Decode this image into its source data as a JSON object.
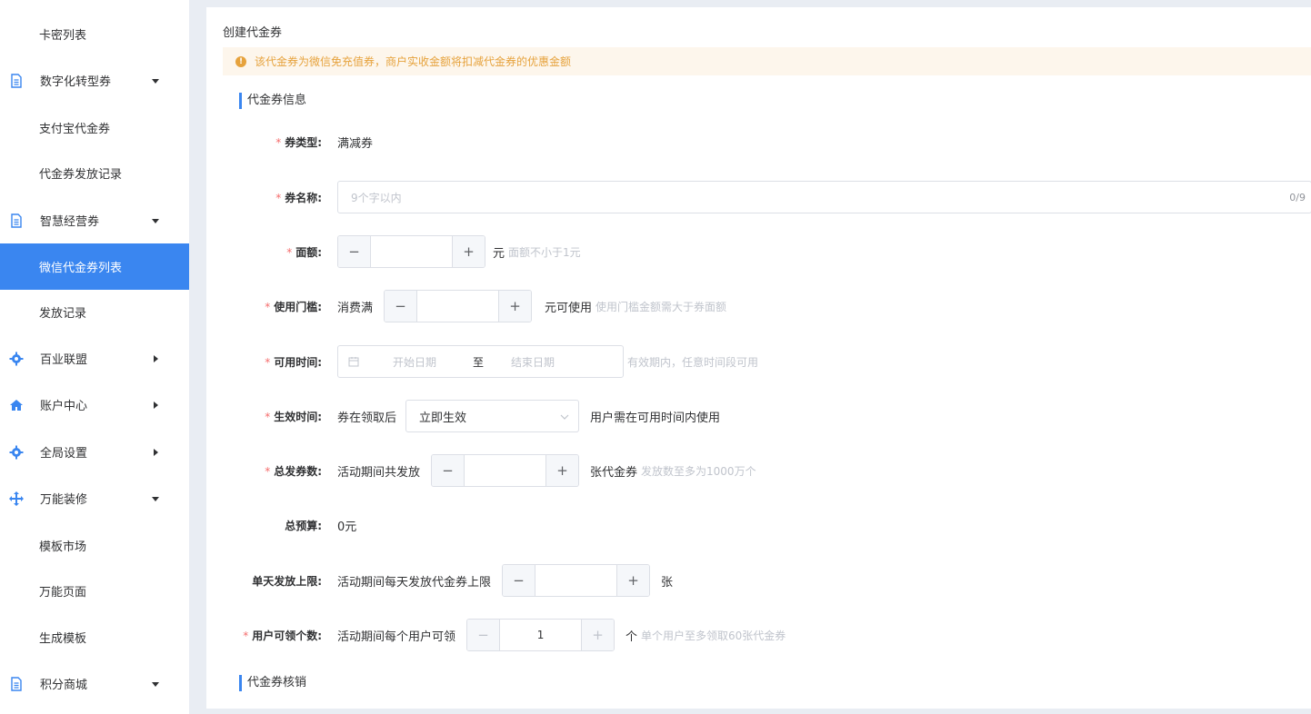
{
  "sidebar": {
    "items": [
      {
        "label": "卡密列表"
      },
      {
        "label": "数字化转型券",
        "icon": "document-icon"
      },
      {
        "label": "支付宝代金券"
      },
      {
        "label": "代金券发放记录"
      },
      {
        "label": "智慧经营券",
        "icon": "document-icon"
      },
      {
        "label": "微信代金券列表",
        "active": true
      },
      {
        "label": "发放记录"
      },
      {
        "label": "百业联盟",
        "icon": "gear-icon"
      },
      {
        "label": "账户中心",
        "icon": "home-icon"
      },
      {
        "label": "全局设置",
        "icon": "gear-icon"
      },
      {
        "label": "万能装修",
        "icon": "move-icon"
      },
      {
        "label": "模板市场"
      },
      {
        "label": "万能页面"
      },
      {
        "label": "生成模板"
      },
      {
        "label": "积分商城",
        "icon": "document-icon"
      }
    ]
  },
  "panel": {
    "title": "创建代金券",
    "alert": "该代金券为微信免充值券，商户实收金额将扣减代金券的优惠金额",
    "section_info": "代金券信息",
    "section_verify": "代金券核销"
  },
  "form": {
    "type": {
      "label": "券类型:",
      "value": "满减券"
    },
    "name": {
      "label": "券名称:",
      "placeholder": "9个字以内",
      "count": "0/9"
    },
    "amount": {
      "label": "面额:",
      "unit": "元",
      "hint": "面额不小于1元"
    },
    "threshold": {
      "label": "使用门槛:",
      "prefix": "消费满",
      "suffix": "元可使用",
      "hint": "使用门槛金额需大于券面额"
    },
    "available": {
      "label": "可用时间:",
      "start": "开始日期",
      "sep": "至",
      "end": "结束日期",
      "hint": "有效期内，任意时间段可用"
    },
    "effective": {
      "label": "生效时间:",
      "prefix": "券在领取后",
      "selected": "立即生效",
      "suffix": "用户需在可用时间内使用"
    },
    "total": {
      "label": "总发券数:",
      "prefix": "活动期间共发放",
      "suffix": "张代金券",
      "hint": "发放数至多为1000万个"
    },
    "budget": {
      "label": "总预算:",
      "value": "0元"
    },
    "daily": {
      "label": "单天发放上限:",
      "prefix": "活动期间每天发放代金券上限",
      "suffix": "张"
    },
    "per_user": {
      "label": "用户可领个数:",
      "prefix": "活动期间每个用户可领",
      "value": "1",
      "suffix": "个",
      "hint": "单个用户至多领取60张代金券"
    }
  },
  "colors": {
    "accent": "#3a86f0",
    "warning": "#e6a23c",
    "required": "#f56c6c"
  }
}
